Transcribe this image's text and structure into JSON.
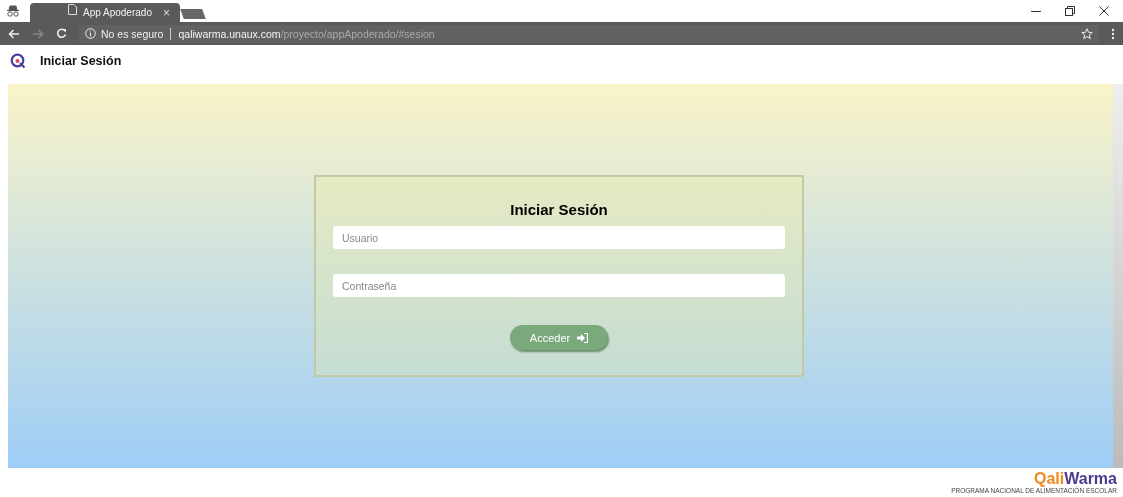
{
  "browser": {
    "tab_title": "App Apoderado",
    "tab_close": "×",
    "security": "No es seguro",
    "url_host": "qaliwarma.unaux.com",
    "url_path": "/proyecto/appApoderado/#sesion"
  },
  "header": {
    "title": "Iniciar Sesión"
  },
  "login": {
    "title": "Iniciar Sesión",
    "fields": [
      {
        "placeholder": "Usuario"
      },
      {
        "placeholder": "Contraseña"
      }
    ],
    "button": "Acceder"
  },
  "footer": {
    "logo_part_1": "Qali",
    "logo_part_2": "Warma",
    "tagline": "PROGRAMA NACIONAL DE ALIMENTACIÓN ESCOLAR"
  }
}
